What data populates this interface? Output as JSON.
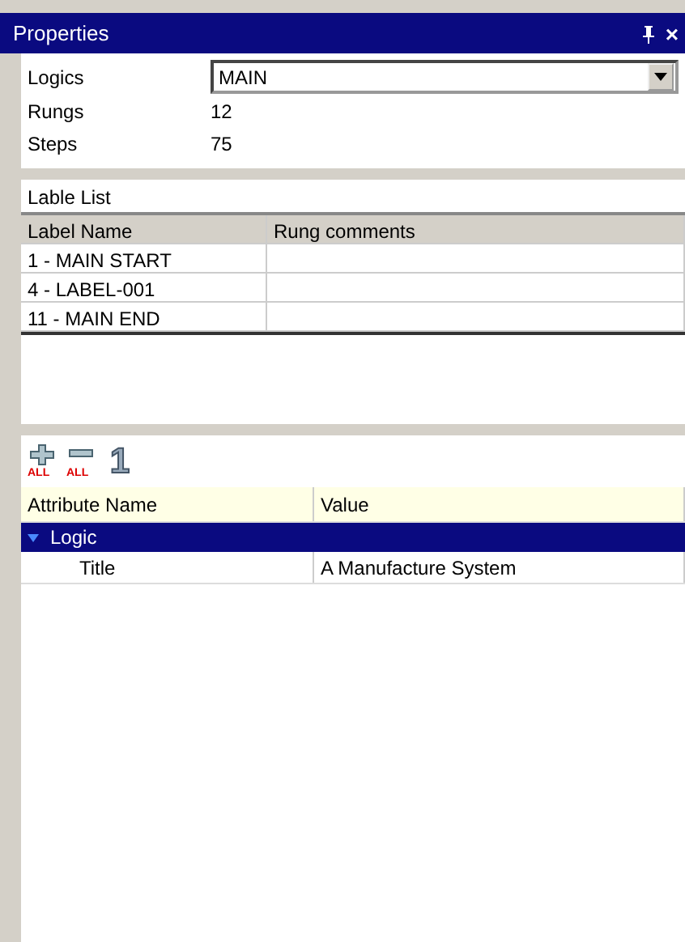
{
  "window": {
    "title": "Properties",
    "buttons": [
      "×"
    ]
  },
  "summary": {
    "logics_label": "Logics",
    "logics_value": "MAIN",
    "rungs_label": "Rungs",
    "rungs_value": "12",
    "steps_label": "Steps",
    "steps_value": "75"
  },
  "label_list": {
    "title": "Lable List",
    "columns": [
      "Label Name",
      "Rung comments"
    ],
    "rows": [
      [
        "1 - MAIN START",
        ""
      ],
      [
        "4 - LABEL-001",
        ""
      ],
      [
        "11 - MAIN END",
        ""
      ]
    ]
  },
  "toolbar": [
    {
      "kind": "expand_all",
      "label": "ALL"
    },
    {
      "kind": "collapse_all",
      "label": "ALL"
    },
    {
      "kind": "single",
      "label": "1"
    }
  ],
  "attributes": {
    "columns": [
      "Attribute Name",
      "Value"
    ],
    "groups": [
      {
        "name": "Logic",
        "expanded": true,
        "selected": true,
        "children": [
          {
            "name": "Title",
            "value": "A Manufacture System"
          }
        ]
      }
    ]
  }
}
